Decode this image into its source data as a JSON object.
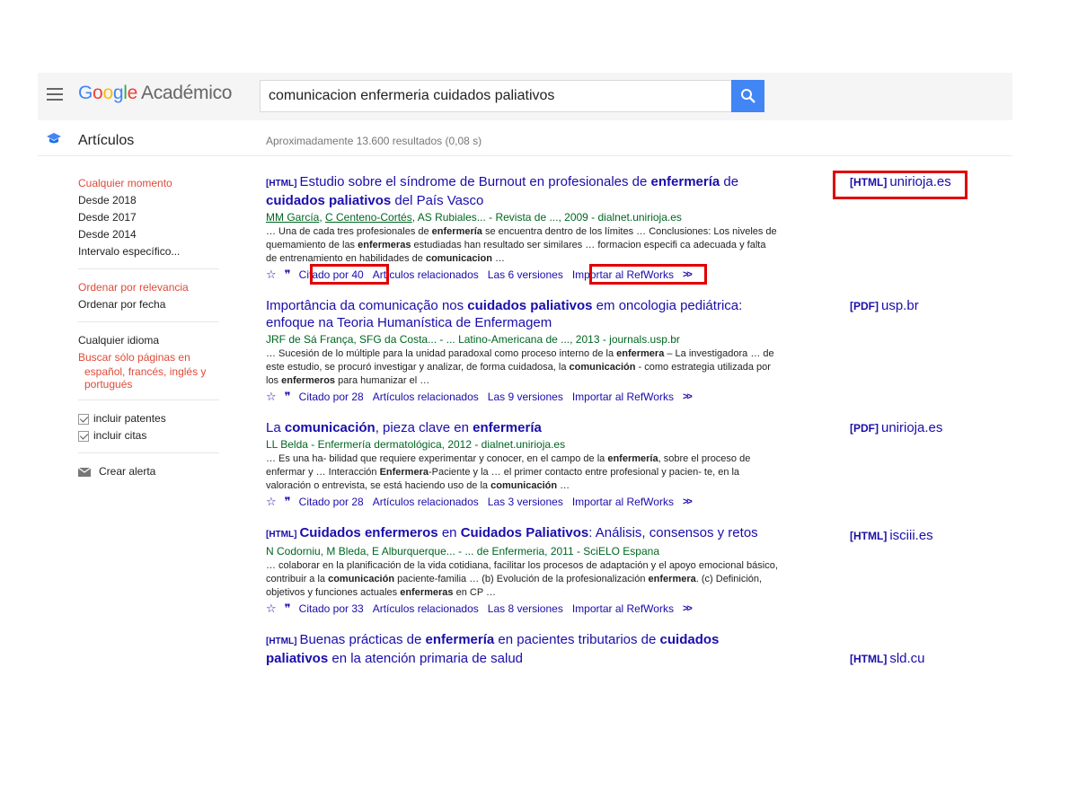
{
  "header": {
    "logo": {
      "g1": "G",
      "o1": "o",
      "o2": "o",
      "g2": "g",
      "l": "l",
      "e": "e",
      "suffix": "Académico"
    },
    "search_value": "comunicacion enfermeria cuidados paliativos"
  },
  "subbar": {
    "section_label": "Artículos",
    "result_count": "Aproximadamente 13.600 resultados (0,08 s)"
  },
  "sidebar": {
    "time_filters": [
      "Cualquier momento",
      "Desde 2018",
      "Desde 2017",
      "Desde 2014",
      "Intervalo específico..."
    ],
    "sort_options": [
      "Ordenar por relevancia",
      "Ordenar por fecha"
    ],
    "language_any": "Cualquier idioma",
    "language_specific_line1": "Buscar sólo páginas en",
    "language_specific_line2": "español, francés, inglés y",
    "language_specific_line3": "portugués",
    "include_patents": "incluir patentes",
    "include_citations": "incluir citas",
    "create_alert": "Crear alerta"
  },
  "results": [
    {
      "tag": "[HTML]",
      "title_parts": [
        "Estudio sobre el síndrome de Burnout en profesionales de ",
        "enfermería",
        " de ",
        "cuidados paliativos",
        " del País Vasco"
      ],
      "authors": [
        "MM García",
        "C Centeno-Cortés"
      ],
      "meta_rest": ", AS Rubiales... - Revista de ..., 2009 - dialnet.unirioja.es",
      "snippet_parts": [
        "… Una de cada tres profesionales de ",
        "enfermería",
        " se encuentra dentro de los límites … Conclusiones: Los niveles de quemamiento de las ",
        "enfermeras",
        " estudiadas han resultado ser similares … formacion especifi ca adecuada y falta de entrenamiento en habilidades de ",
        "comunicacion",
        " …"
      ],
      "cited": "Citado por 40",
      "related": "Artículos relacionados",
      "versions": "Las 6 versiones",
      "import": "Importar al RefWorks",
      "side_tag": "[HTML]",
      "side_domain": "unirioja.es"
    },
    {
      "tag": "",
      "title_parts": [
        "Importância da comunicação nos ",
        "cuidados paliativos",
        " em oncologia pediátrica: enfoque na Teoria Humanística de Enfermagem",
        "",
        ""
      ],
      "authors": [],
      "meta_rest": "JRF de Sá França, SFG da Costa... - ... Latino-Americana de ..., 2013 - journals.usp.br",
      "snippet_parts": [
        "… Sucesión de lo múltiple para la unidad paradoxal como proceso interno de la ",
        "enfermera",
        " – La investigadora … de este estudio, se procuró investigar y analizar, de forma cuidadosa, la ",
        "comunicación",
        " - como estrategia utilizada por los ",
        "enfermeros",
        " para humanizar el …"
      ],
      "cited": "Citado por 28",
      "related": "Artículos relacionados",
      "versions": "Las 9 versiones",
      "import": "Importar al RefWorks",
      "side_tag": "[PDF]",
      "side_domain": "usp.br"
    },
    {
      "tag": "",
      "title_parts": [
        "La ",
        "comunicación",
        ", pieza clave en ",
        "enfermería",
        ""
      ],
      "authors": [],
      "meta_rest": "LL Belda - Enfermería dermatológica, 2012 - dialnet.unirioja.es",
      "snippet_parts": [
        "… Es una ha- bilidad que requiere experimentar y conocer, en el campo de la ",
        "enfermería",
        ", sobre el proceso de enfermar y … Interacción ",
        "Enfermera",
        "-Paciente y la … el primer contacto entre profesional y pacien- te, en la valoración o entrevista, se está haciendo uso de la ",
        "comunicación",
        " …"
      ],
      "cited": "Citado por 28",
      "related": "Artículos relacionados",
      "versions": "Las 3 versiones",
      "import": "Importar al RefWorks",
      "side_tag": "[PDF]",
      "side_domain": "unirioja.es"
    },
    {
      "tag": "[HTML]",
      "title_parts": [
        "",
        "Cuidados enfermeros",
        " en ",
        "Cuidados Paliativos",
        ": Análisis, consensos y retos"
      ],
      "authors": [],
      "meta_rest": "N Codorniu, M Bleda, E Alburquerque... - ... de Enfermeria, 2011 - SciELO Espana",
      "snippet_parts": [
        "… colaborar en la planificación de la vida cotidiana, facilitar los procesos de adaptación y el apoyo emocional básico, contribuir a la ",
        "comunicación",
        " paciente-familia … (b) Evolución de la profesionalización ",
        "enfermera",
        ". (c) Definición, objetivos y funciones actuales ",
        "enfermeras",
        " en CP …"
      ],
      "cited": "Citado por 33",
      "related": "Artículos relacionados",
      "versions": "Las 8 versiones",
      "import": "Importar al RefWorks",
      "side_tag": "[HTML]",
      "side_domain": "isciii.es"
    },
    {
      "tag": "[HTML]",
      "title_parts": [
        "Buenas prácticas de ",
        "enfermería",
        " en pacientes tributarios de ",
        "cuidados paliativos",
        " en la atención primaria de salud"
      ],
      "authors": [],
      "meta_rest": "",
      "snippet_parts": [],
      "cited": "",
      "related": "",
      "versions": "",
      "import": "",
      "side_tag": "[HTML]",
      "side_domain": "sld.cu"
    }
  ],
  "colors": {
    "accent_blue": "#4285f4",
    "link": "#1a0dab",
    "meta_green": "#006621",
    "active_red": "#dd4b39",
    "highlight_red": "#e00000"
  }
}
